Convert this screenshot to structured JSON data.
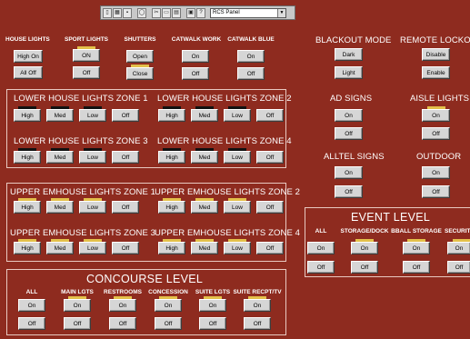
{
  "toolbar": {
    "panel_select": "RCS Panel",
    "icons": [
      "document-icon",
      "grid-icon",
      "save-icon",
      "zoom-icon",
      "cut-icon",
      "copy-icon",
      "paste-icon",
      "print-icon",
      "help-icon"
    ]
  },
  "top_groups": [
    {
      "label": "HOUSE LIGHTS",
      "on": "High On",
      "off": "All Off",
      "ind": "n"
    },
    {
      "label": "SPORT LIGHTS",
      "on": "ON",
      "off": "Off",
      "ind": "y"
    },
    {
      "label": "SHUTTERS",
      "on": "Open",
      "off": "Close",
      "ind": "n",
      "ind2": "y"
    },
    {
      "label": "CATWALK WORK",
      "on": "On",
      "off": "Off",
      "ind": "n"
    },
    {
      "label": "CATWALK BLUE",
      "on": "On",
      "off": "Off",
      "ind": "n"
    }
  ],
  "blackout": {
    "label": "BLACKOUT MODE",
    "dark": "Dark",
    "light": "Light"
  },
  "remote_lockout": {
    "label": "REMOTE LOCKOUT",
    "disable": "Disable",
    "enable": "Enable"
  },
  "lower_zones": [
    {
      "label": "LOWER HOUSE LIGHTS  ZONE 1",
      "buttons": [
        "High",
        "Med",
        "Low",
        "Off"
      ],
      "ind": [
        "k",
        "k",
        "k",
        "n"
      ]
    },
    {
      "label": "LOWER HOUSE LIGHTS  ZONE 2",
      "buttons": [
        "High",
        "Med",
        "Low",
        "Off"
      ],
      "ind": [
        "k",
        "k",
        "k",
        "n"
      ]
    },
    {
      "label": "LOWER HOUSE LIGHTS  ZONE 3",
      "buttons": [
        "High",
        "Med",
        "Low",
        "Off"
      ],
      "ind": [
        "k",
        "k",
        "k",
        "n"
      ]
    },
    {
      "label": "LOWER HOUSE LIGHTS  ZONE 4",
      "buttons": [
        "High",
        "Med",
        "Low",
        "Off"
      ],
      "ind": [
        "k",
        "k",
        "k",
        "n"
      ]
    }
  ],
  "upper_zones": [
    {
      "label": "UPPER EMHOUSE LIGHTS ZONE 1",
      "buttons": [
        "High",
        "Med",
        "Low",
        "Off"
      ],
      "ind": [
        "y",
        "y",
        "y",
        "n"
      ]
    },
    {
      "label": "UPPER EMHOUSE LIGHTS ZONE 2",
      "buttons": [
        "High",
        "Med",
        "Low",
        "Off"
      ],
      "ind": [
        "y",
        "y",
        "y",
        "n"
      ]
    },
    {
      "label": "UPPER EMHOUSE LIGHTS ZONE 3",
      "buttons": [
        "High",
        "Med",
        "Low",
        "Off"
      ],
      "ind": [
        "y",
        "y",
        "y",
        "n"
      ]
    },
    {
      "label": "UPPER EMHOUSE LIGHTS ZONE 4",
      "buttons": [
        "High",
        "Med",
        "Low",
        "Off"
      ],
      "ind": [
        "y",
        "y",
        "y",
        "n"
      ]
    }
  ],
  "ad_signs": {
    "label": "AD SIGNS",
    "on": "On",
    "off": "Off"
  },
  "aisle_lights": {
    "label": "AISLE LIGHTS",
    "on": "On",
    "off": "Off"
  },
  "alltel_signs": {
    "label": "ALLTEL SIGNS",
    "on": "On",
    "off": "Off"
  },
  "outdoor": {
    "label": "OUTDOOR",
    "on": "On",
    "off": "Off"
  },
  "event_level": {
    "title": "EVENT LEVEL",
    "groups": [
      {
        "label": "ALL",
        "on": "On",
        "off": "Off"
      },
      {
        "label": "STORAGE/DOCK",
        "on": "On",
        "off": "Off"
      },
      {
        "label": "BBALL STORAGE",
        "on": "On",
        "off": "Off"
      },
      {
        "label": "SECURITY",
        "on": "On",
        "off": "Off"
      }
    ]
  },
  "concourse_level": {
    "title": "CONCOURSE LEVEL",
    "groups": [
      {
        "label": "ALL",
        "on": "On",
        "off": "Off"
      },
      {
        "label": "MAIN LGTS",
        "on": "On",
        "off": "Off"
      },
      {
        "label": "RESTROOMS",
        "on": "On",
        "off": "Off"
      },
      {
        "label": "CONCESSION",
        "on": "On",
        "off": "Off"
      },
      {
        "label": "SUITE LGTS",
        "on": "On",
        "off": "Off"
      },
      {
        "label": "SUITE RECPT/TV",
        "on": "On",
        "off": "Off"
      }
    ]
  }
}
